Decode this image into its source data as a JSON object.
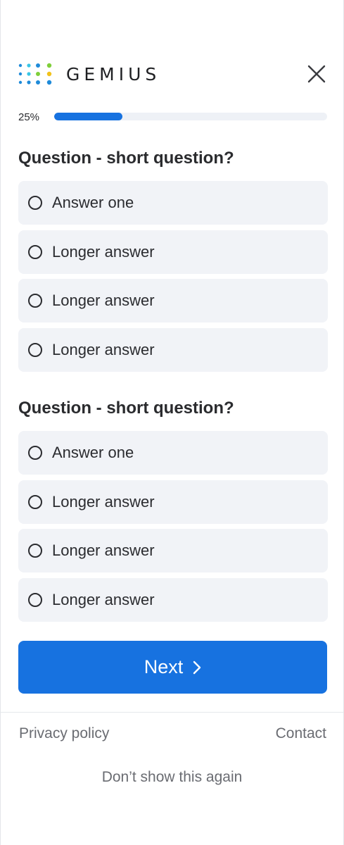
{
  "header": {
    "logo_text": "GEMIUS",
    "logo_icon": "dot-grid-logo-icon",
    "close_icon": "close-icon"
  },
  "progress": {
    "label": "25%",
    "value": 0.25
  },
  "questions": [
    {
      "title": "Question - short question?",
      "answers": [
        "Answer one",
        "Longer answer",
        "Longer answer",
        "Longer answer"
      ]
    },
    {
      "title": "Question - short question?",
      "answers": [
        "Answer one",
        "Longer answer",
        "Longer answer",
        "Longer answer"
      ]
    }
  ],
  "actions": {
    "next_label": "Next",
    "next_icon": "chevron-right-icon"
  },
  "footer": {
    "privacy_label": "Privacy policy",
    "contact_label": "Contact",
    "dont_show_label": "Don’t show this again"
  },
  "colors": {
    "accent": "#1772e0",
    "answer_bg": "#f1f3f7",
    "logo_blue": "#1f8bd9",
    "logo_cyan": "#39c6e6",
    "logo_green": "#7fcf3a",
    "logo_yellow": "#f2c21b"
  }
}
